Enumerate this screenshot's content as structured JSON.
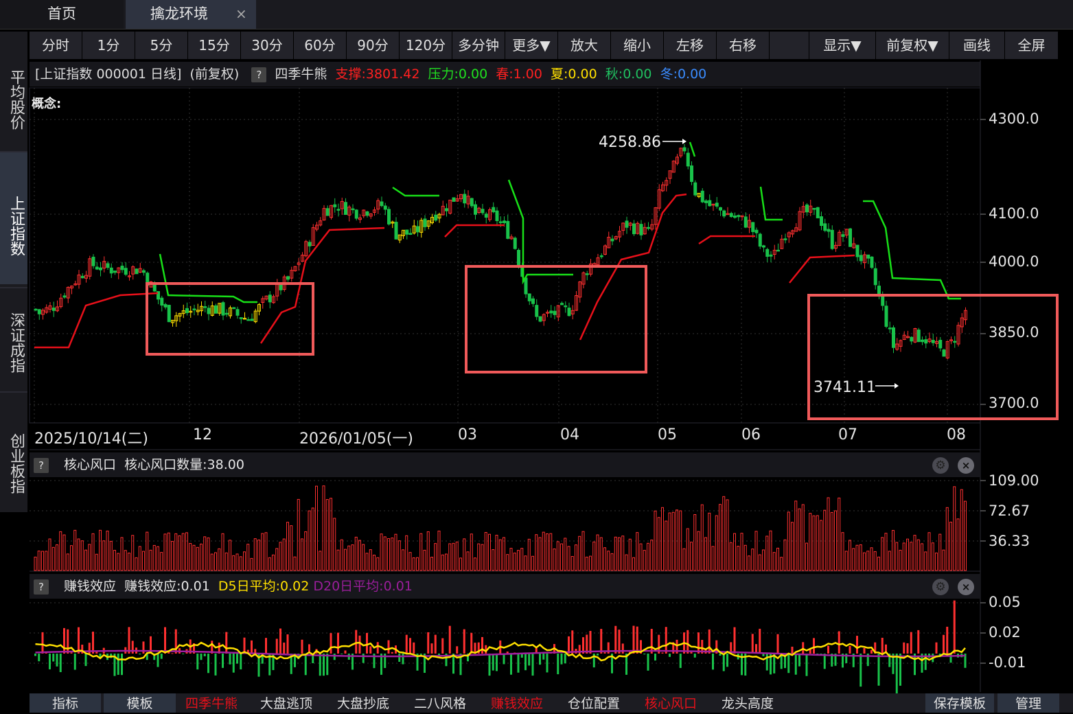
{
  "tabs": [
    {
      "label": "首页"
    },
    {
      "label": "擒龙环境",
      "close": "×"
    }
  ],
  "sidebar": [
    {
      "label": "平均股价"
    },
    {
      "label": "上证指数"
    },
    {
      "label": "深证成指"
    },
    {
      "label": "创业板指"
    }
  ],
  "toolbar": [
    "分时",
    "1分",
    "5分",
    "15分",
    "30分",
    "60分",
    "90分",
    "120分",
    "多分钟",
    "更多▼",
    "放大",
    "缩小",
    "左移",
    "右移",
    "",
    "显示▼",
    "前复权▼",
    "画线",
    "全屏"
  ],
  "header": {
    "symbol": "[上证指数 000001 日线]",
    "adjust": "(前复权)",
    "help": "?",
    "indicator": "四季牛熊",
    "support": "支撑:3801.42",
    "pressure": "压力:0.00",
    "spring": "春:1.00",
    "summer": "夏:0.00",
    "autumn": "秋:0.00",
    "winter": "冬:0.00",
    "concept": "概念:"
  },
  "colors": {
    "up": "#ff3030",
    "down": "#19c24a",
    "yellow": "#ffe000",
    "support_line": "#e8101a",
    "pressure_line": "#18e018",
    "highlight_box": "#f05a5a",
    "purple": "#a020a0"
  },
  "price_axis": [
    "4300.0",
    "4100.0",
    "4000.0",
    "3850.0",
    "3700.0"
  ],
  "date_axis": [
    "2025/10/14(二)",
    "12",
    "2026/01/05(一)",
    "03",
    "04",
    "05",
    "06",
    "07",
    "08"
  ],
  "annotations": {
    "high": "4258.86",
    "low": "3741.11"
  },
  "panel_hot": {
    "help": "?",
    "title": "核心风口",
    "value_label": "核心风口数量:38.00",
    "axis": [
      "109.00",
      "72.67",
      "36.33"
    ]
  },
  "panel_money": {
    "help": "?",
    "title": "赚钱效应",
    "value_label": "赚钱效应:0.01",
    "d5": "D5日平均:0.02",
    "d20": "D20日平均:0.01",
    "axis": [
      "0.05",
      "0.02",
      "-0.01"
    ]
  },
  "bottom_bar": [
    {
      "label": "指标",
      "color": "#e0e0e0"
    },
    {
      "label": "模板",
      "color": "#e0e0e0"
    },
    {
      "label": "四季牛熊",
      "color": "#e8101a"
    },
    {
      "label": "大盘逃顶",
      "color": "#e0e0e0"
    },
    {
      "label": "大盘抄底",
      "color": "#e0e0e0"
    },
    {
      "label": "二八风格",
      "color": "#e0e0e0"
    },
    {
      "label": "赚钱效应",
      "color": "#e8101a"
    },
    {
      "label": "仓位配置",
      "color": "#e0e0e0"
    },
    {
      "label": "核心风口",
      "color": "#e8101a"
    },
    {
      "label": "龙头高度",
      "color": "#e0e0e0"
    },
    {
      "label": "保存模板",
      "color": "#e0e0e0"
    },
    {
      "label": "管理",
      "color": "#e0e0e0"
    }
  ]
}
